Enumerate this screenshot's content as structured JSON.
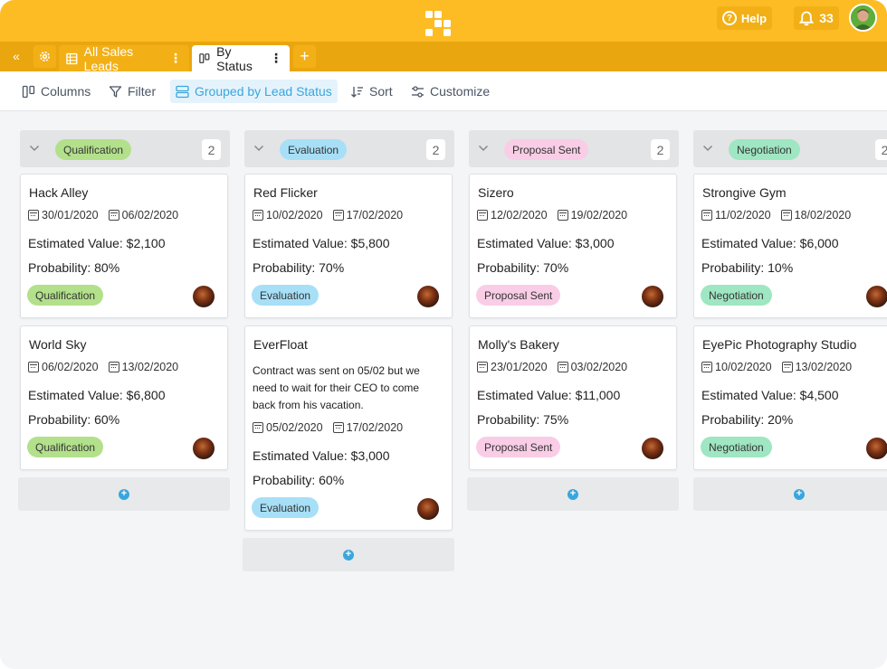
{
  "colors": {
    "topbar": "#fdbc24",
    "tabbar": "#eaa60f",
    "accent": "#3aa6dd",
    "qualification": "#b3e08b",
    "evaluation": "#a7dff7",
    "proposal_sent": "#f9cde6",
    "negotiation": "#9fe6c3"
  },
  "header": {
    "help_label": "Help",
    "notification_count": "33"
  },
  "tabs": {
    "collapse_icon": "«",
    "items": [
      {
        "label": "All Sales Leads",
        "icon": "grid-icon",
        "active": false
      },
      {
        "label": "By Status",
        "icon": "kanban-icon",
        "active": true
      }
    ],
    "more_icon": "⋮",
    "add_icon": "+"
  },
  "toolbar": {
    "columns_label": "Columns",
    "filter_label": "Filter",
    "group_label": "Grouped by Lead Status",
    "sort_label": "Sort",
    "customize_label": "Customize"
  },
  "board": {
    "columns": [
      {
        "name": "Qualification",
        "count": "2",
        "color_key": "qualification",
        "cards": [
          {
            "title": "Hack Alley",
            "start": "30/01/2020",
            "end": "06/02/2020",
            "value": "Estimated Value: $2,100",
            "probability": "Probability: 80%",
            "status": "Qualification"
          },
          {
            "title": "World Sky",
            "start": "06/02/2020",
            "end": "13/02/2020",
            "value": "Estimated Value: $6,800",
            "probability": "Probability: 60%",
            "status": "Qualification"
          }
        ]
      },
      {
        "name": "Evaluation",
        "count": "2",
        "color_key": "evaluation",
        "cards": [
          {
            "title": "Red Flicker",
            "start": "10/02/2020",
            "end": "17/02/2020",
            "value": "Estimated Value: $5,800",
            "probability": "Probability: 70%",
            "status": "Evaluation"
          },
          {
            "title": "EverFloat",
            "description": "Contract was sent on 05/02 but we need to wait for their CEO to come back from his vacation.",
            "start": "05/02/2020",
            "end": "17/02/2020",
            "value": "Estimated Value: $3,000",
            "probability": "Probability: 60%",
            "status": "Evaluation"
          }
        ]
      },
      {
        "name": "Proposal Sent",
        "count": "2",
        "color_key": "proposal_sent",
        "cards": [
          {
            "title": "Sizero",
            "start": "12/02/2020",
            "end": "19/02/2020",
            "value": "Estimated Value: $3,000",
            "probability": "Probability: 70%",
            "status": "Proposal Sent"
          },
          {
            "title": "Molly's Bakery",
            "start": "23/01/2020",
            "end": "03/02/2020",
            "value": "Estimated Value: $11,000",
            "probability": "Probability: 75%",
            "status": "Proposal Sent"
          }
        ]
      },
      {
        "name": "Negotiation",
        "count": "2",
        "color_key": "negotiation",
        "cards": [
          {
            "title": "Strongive Gym",
            "start": "11/02/2020",
            "end": "18/02/2020",
            "value": "Estimated Value: $6,000",
            "probability": "Probability: 10%",
            "status": "Negotiation"
          },
          {
            "title": "EyePic Photography Studio",
            "start": "10/02/2020",
            "end": "13/02/2020",
            "value": "Estimated Value: $4,500",
            "probability": "Probability: 20%",
            "status": "Negotiation"
          }
        ]
      }
    ]
  }
}
